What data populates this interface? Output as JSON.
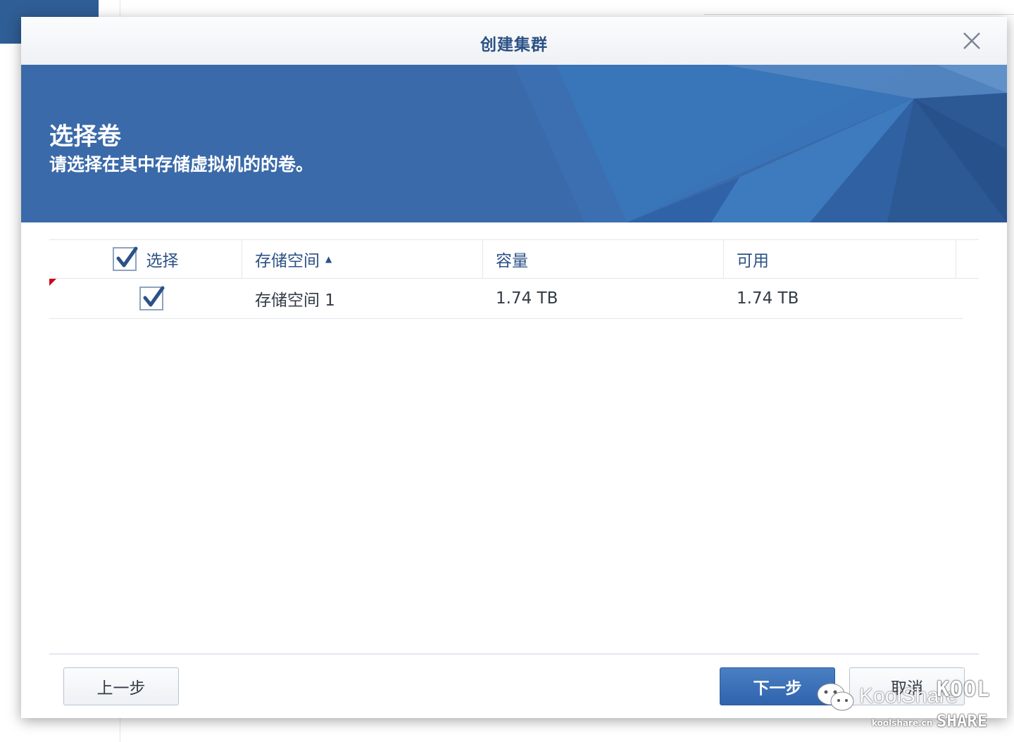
{
  "dialog": {
    "title": "创建集群",
    "close_icon": "close-icon"
  },
  "banner": {
    "heading": "选择卷",
    "subheading": "请选择在其中存储虚拟机的的卷。"
  },
  "grid": {
    "columns": [
      {
        "label": "选择"
      },
      {
        "label": "存储空间",
        "sort": "ascending"
      },
      {
        "label": "容量"
      },
      {
        "label": "可用"
      }
    ],
    "select_all_checked": true,
    "rows": [
      {
        "checked": true,
        "volume": "存储空间 1",
        "capacity": "1.74 TB",
        "available": "1.74 TB"
      }
    ]
  },
  "footer": {
    "back_label": "上一步",
    "next_label": "下一步",
    "cancel_label": "取消"
  },
  "watermark": {
    "brand": "KoolShare",
    "url": "koolshare.cn",
    "logo_top": "KOOL",
    "logo_bottom": "SHARE"
  },
  "colors": {
    "accent": "#2c5185",
    "banner": "#3a6aa9",
    "primary_button": "#3a6fb5"
  }
}
